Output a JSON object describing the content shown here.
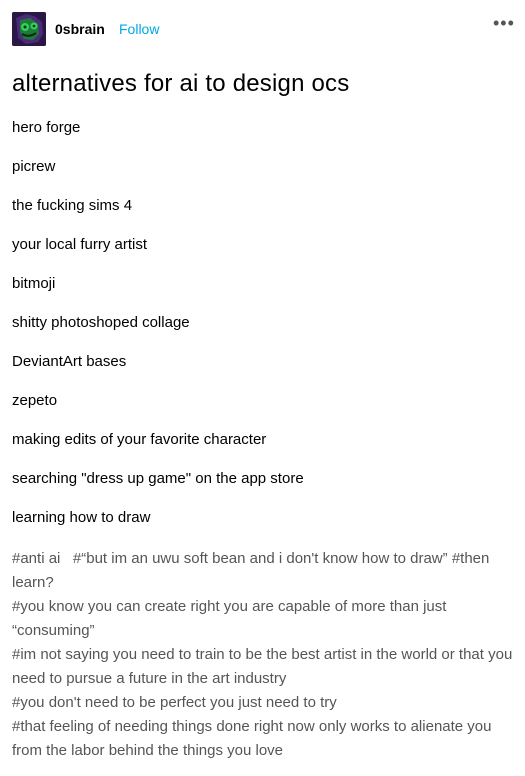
{
  "header": {
    "username": "0sbrain",
    "follow_label": "Follow",
    "more_label": "•••"
  },
  "post": {
    "title": "alternatives for ai to design ocs",
    "items": [
      "hero forge",
      "picrew",
      "the fucking sims 4",
      "your local furry artist",
      "bitmoji",
      "shitty photoshoped collage",
      "DeviantArt bases",
      "zepeto",
      "making edits of your favorite character",
      "searching \"dress up game\" on the app store",
      "learning how to draw"
    ],
    "tags": [
      "#anti ai",
      "#“but im an uwu soft bean and i don't know how to draw”",
      "#then learn?",
      "#you know you can create right you are capable of more than just “consuming”",
      "#im not saying you need to train to be the best artist in the world or that you need to pursue a future in the art industry",
      "#you don't need to be perfect you just need to try",
      "#that feeling of needing things done right now only works to alienate you from the labor behind the things you love"
    ]
  },
  "colors": {
    "follow": "#00a8e6",
    "tags": "#555555",
    "avatar_bg": "#3a1f5a",
    "avatar_fg": "#2fd15a"
  }
}
